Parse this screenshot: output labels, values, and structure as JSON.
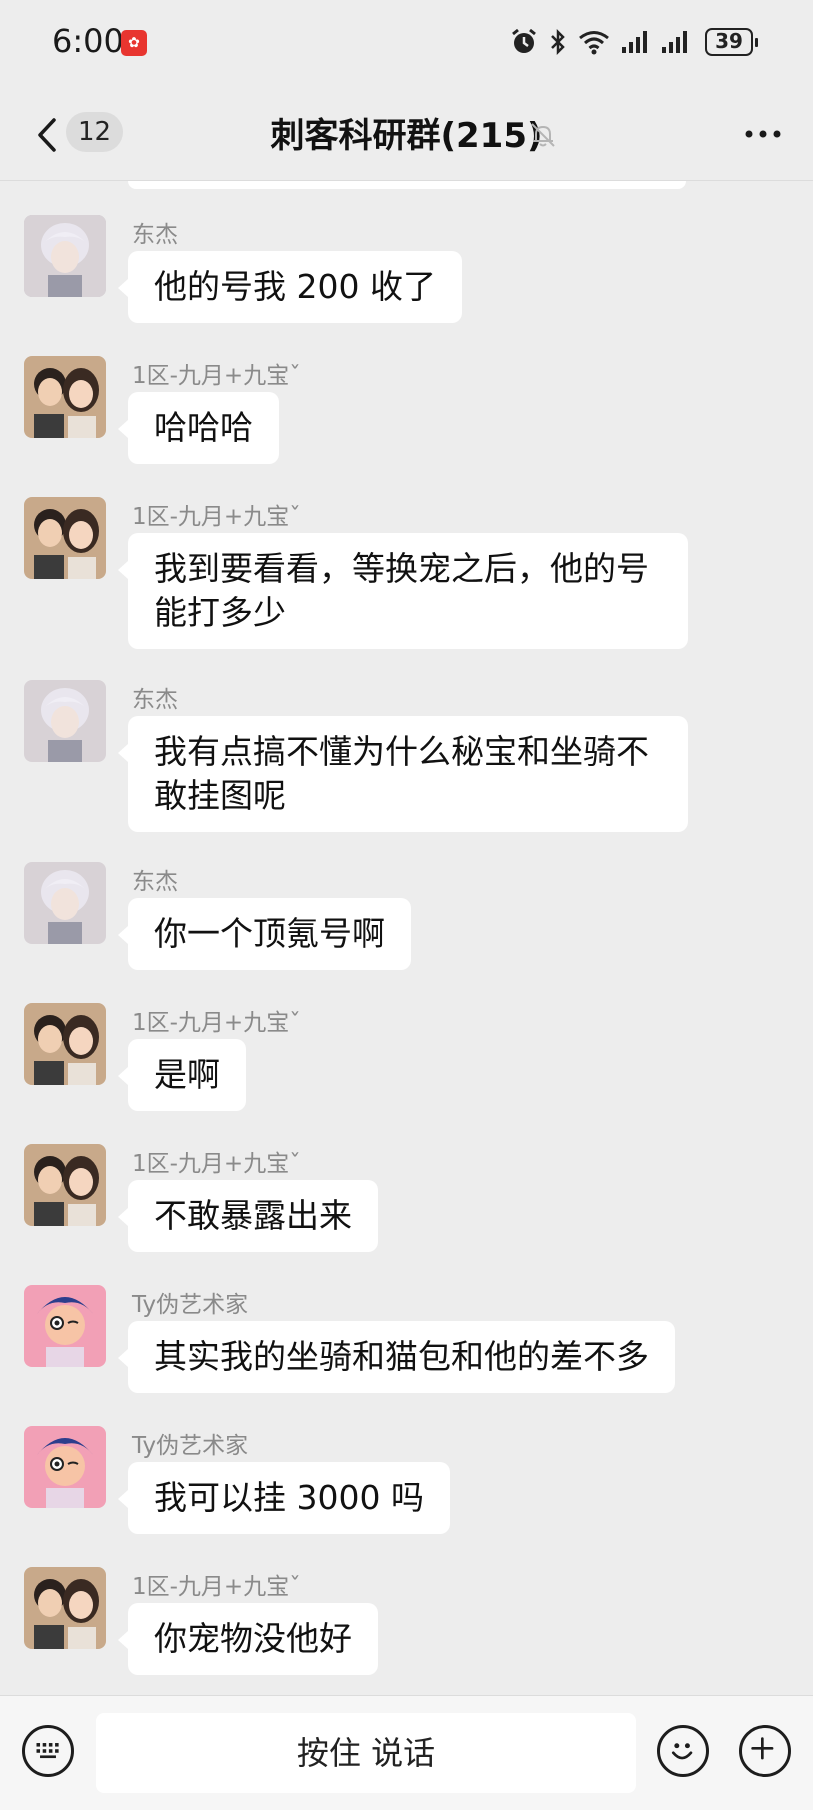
{
  "status_bar": {
    "time": "6:00",
    "battery": "39",
    "network_badge": "6"
  },
  "header": {
    "unread_count": "12",
    "title": "刺客科研群(215)"
  },
  "messages": [
    {
      "sender": "东杰",
      "text": "他的号我 200 收了",
      "avatar": "avatar-silver-hair"
    },
    {
      "sender": "1区-九月+九宝ˇ",
      "text": "哈哈哈",
      "avatar": "avatar-couple"
    },
    {
      "sender": "1区-九月+九宝ˇ",
      "text": "我到要看看，等换宠之后，他的号能打多少",
      "avatar": "avatar-couple"
    },
    {
      "sender": "东杰",
      "text": "我有点搞不懂为什么秘宝和坐骑不敢挂图呢",
      "avatar": "avatar-silver-hair"
    },
    {
      "sender": "东杰",
      "text": "你一个顶氪号啊",
      "avatar": "avatar-silver-hair"
    },
    {
      "sender": "1区-九月+九宝ˇ",
      "text": "是啊",
      "avatar": "avatar-couple"
    },
    {
      "sender": "1区-九月+九宝ˇ",
      "text": "不敢暴露出来",
      "avatar": "avatar-couple"
    },
    {
      "sender": "Ty伪艺术家",
      "text": "其实我的坐骑和猫包和他的差不多",
      "avatar": "avatar-cartoon"
    },
    {
      "sender": "Ty伪艺术家",
      "text": "我可以挂 3000 吗",
      "avatar": "avatar-cartoon"
    },
    {
      "sender": "1区-九月+九宝ˇ",
      "text": "你宠物没他好",
      "avatar": "avatar-couple"
    }
  ],
  "input_bar": {
    "voice_label": "按住 说话"
  },
  "colors": {
    "background": "#ededed",
    "bubble": "#ffffff",
    "sender_name": "#8a8a8a"
  }
}
